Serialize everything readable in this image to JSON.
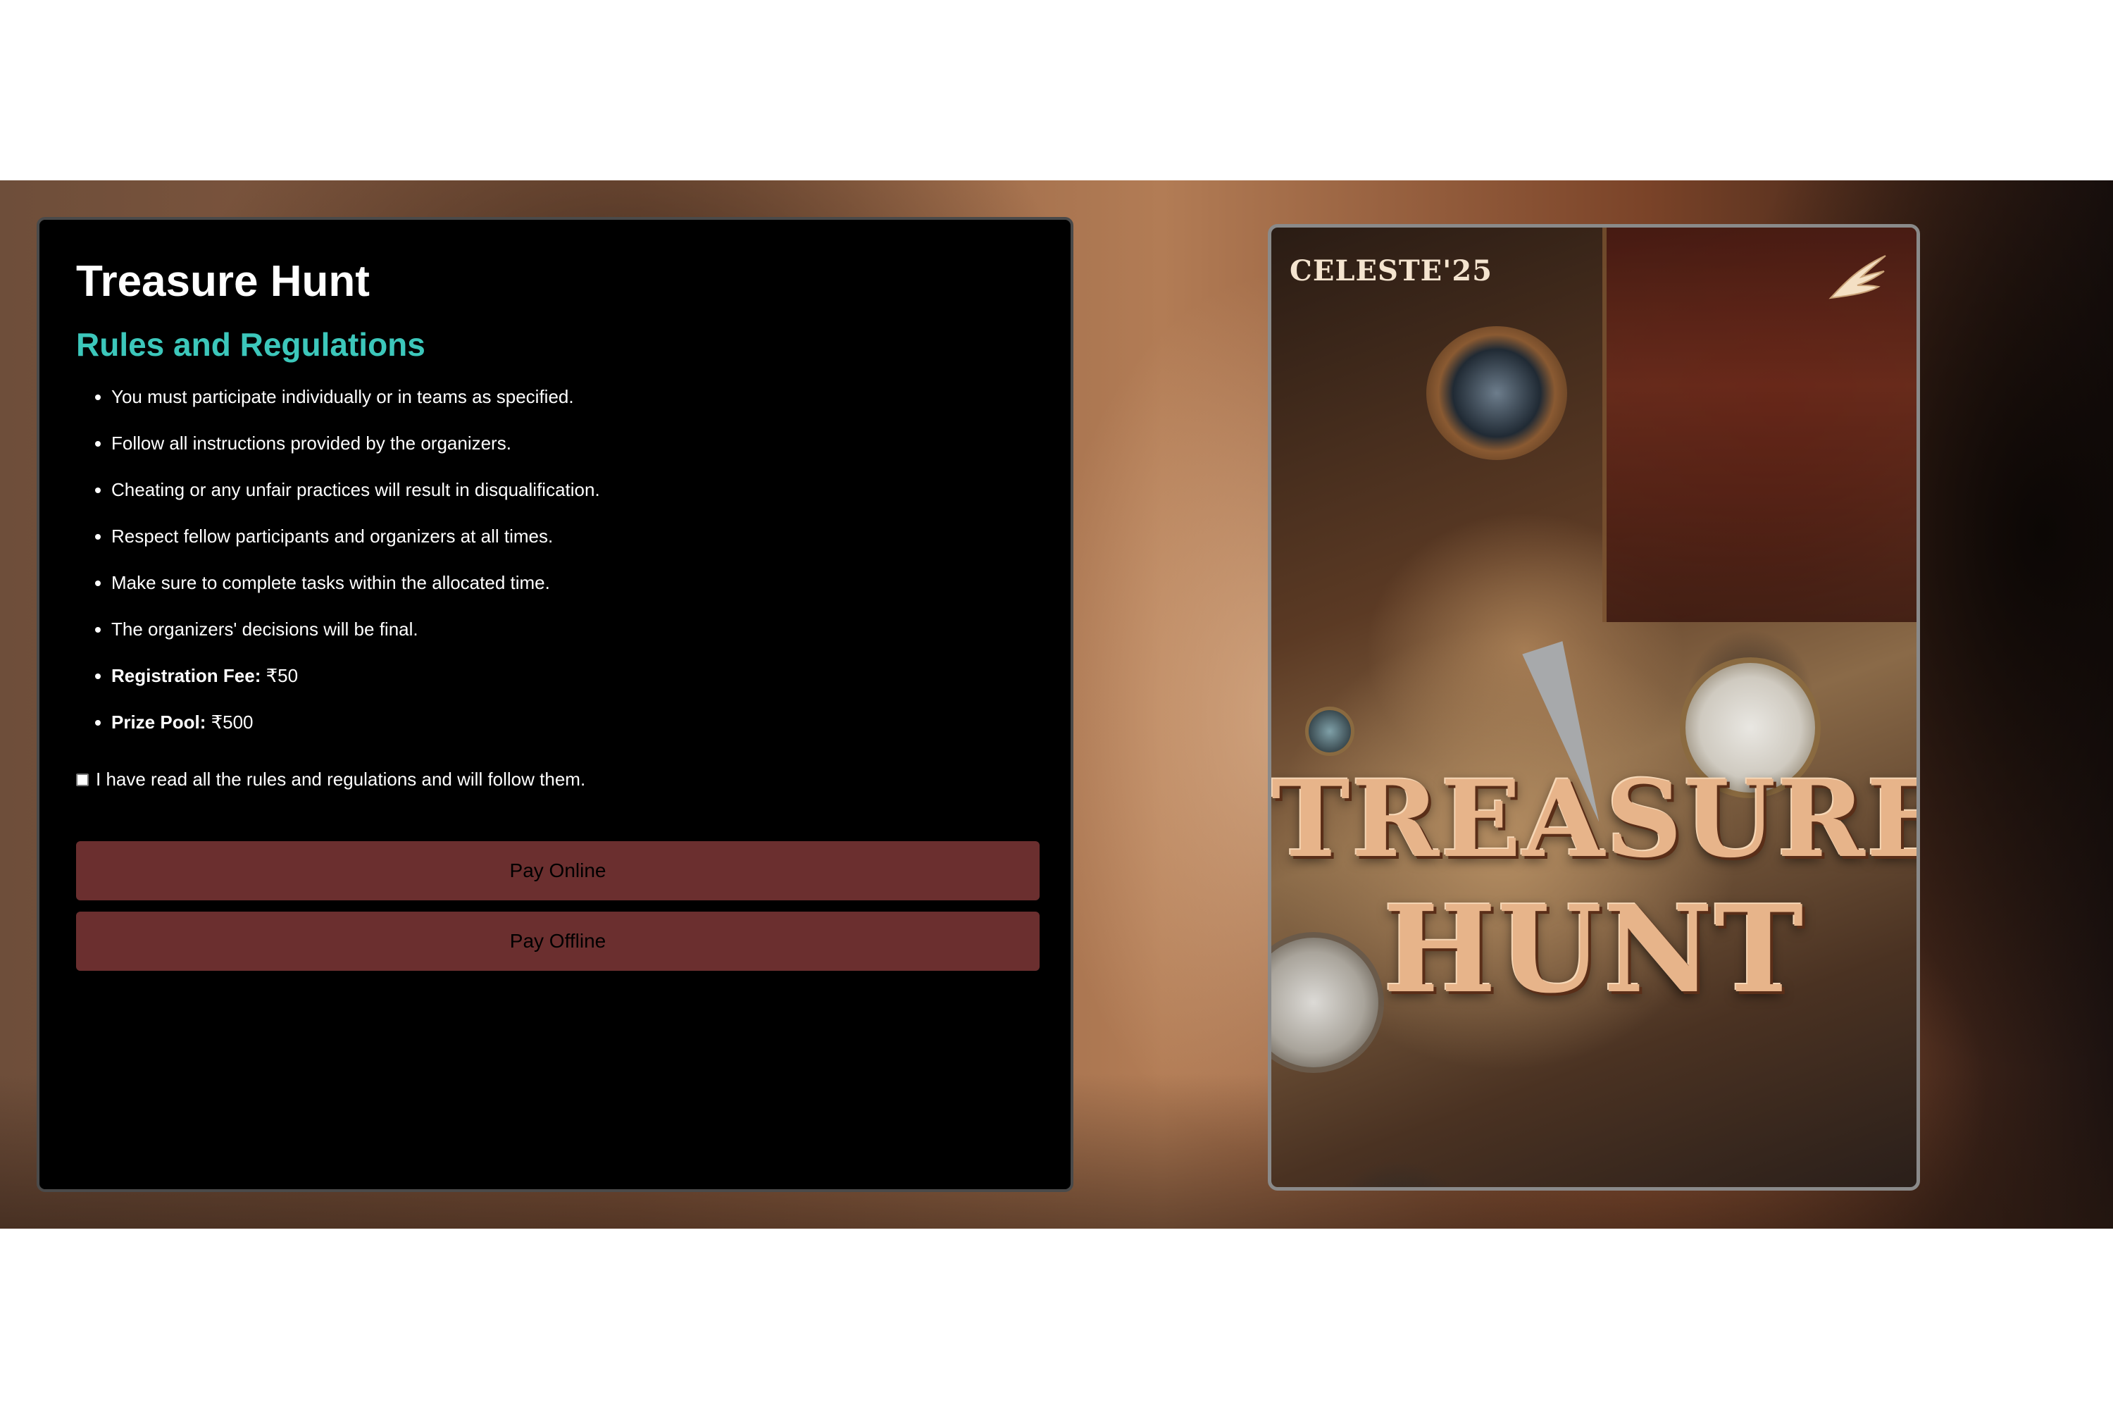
{
  "event": {
    "title": "Treasure Hunt",
    "subtitle": "Rules and Regulations"
  },
  "rules": [
    {
      "text": "You must participate individually or in teams as specified."
    },
    {
      "text": "Follow all instructions provided by the organizers."
    },
    {
      "text": "Cheating or any unfair practices will result in disqualification."
    },
    {
      "text": "Respect fellow participants and organizers at all times."
    },
    {
      "text": "Make sure to complete tasks within the allocated time."
    },
    {
      "text": "The organizers' decisions will be final."
    },
    {
      "label": "Registration Fee:",
      "value": "₹50"
    },
    {
      "label": "Prize Pool:",
      "value": "₹500"
    }
  ],
  "agreement": {
    "text": "I have read all the rules and regulations and will follow them.",
    "checked": false
  },
  "buttons": {
    "pay_online": "Pay Online",
    "pay_offline": "Pay Offline"
  },
  "poster": {
    "brand": "CELESTE'25",
    "title_line1": "TREASURE",
    "title_line2": "HUNT",
    "icons": [
      "wing-icon",
      "compass-icon",
      "cup-icon",
      "chest-icon",
      "knife-icon"
    ]
  },
  "colors": {
    "card_background": "#000000",
    "title_text": "#ffffff",
    "subtitle_accent": "#3cc7bb",
    "button_background": "#6b2f2f",
    "button_text": "#000000"
  }
}
